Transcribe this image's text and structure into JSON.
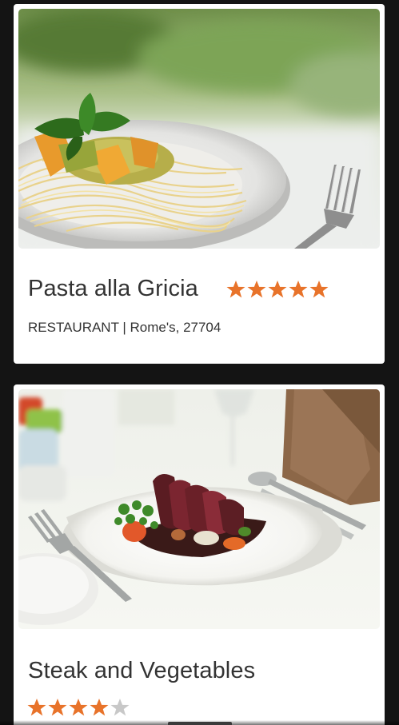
{
  "colors": {
    "background": "#141414",
    "card": "#ffffff",
    "star_filled": "#e8732a",
    "star_empty": "#c8c8c8",
    "text": "#333333"
  },
  "cards": [
    {
      "image_alt": "Spaghetti topped with zucchini flowers and basil on a white plate beside a fork",
      "title": "Pasta alla Gricia",
      "rating": 5,
      "rating_max": 5,
      "meta": "RESTAURANT | Rome's, 27704"
    },
    {
      "image_alt": "Sliced seared steak with roasted vegetables on a white plate beside cutlery and a brown napkin",
      "title": "Steak and Vegetables",
      "rating": 4,
      "rating_max": 5
    }
  ]
}
